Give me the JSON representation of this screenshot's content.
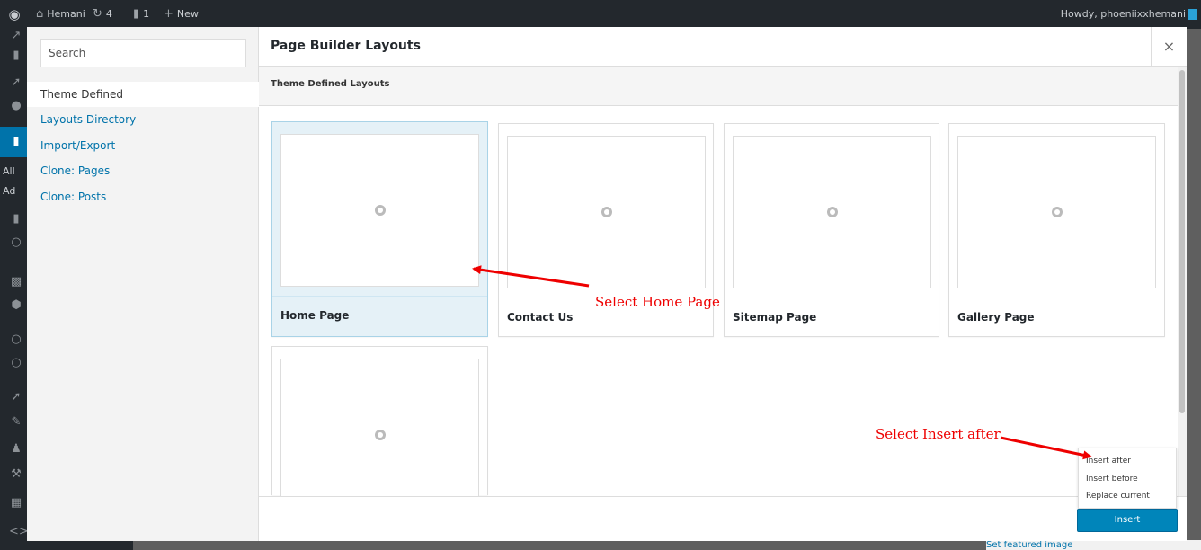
{
  "admin_bar": {
    "wp_logo_icon": "wordpress-icon",
    "site_name": "Hemani",
    "updates_count": "4",
    "comments_count": "1",
    "new_label": "New",
    "howdy": "Howdy, phoeniixxhemani"
  },
  "wp_sidebar": {
    "all_label": "All",
    "add_label": "Ad"
  },
  "modal": {
    "title": "Page Builder Layouts",
    "close_label": "×",
    "search": {
      "placeholder": "Search",
      "value": ""
    },
    "nav": [
      {
        "label": "Theme Defined",
        "selected": true
      },
      {
        "label": "Layouts Directory",
        "selected": false
      },
      {
        "label": "Import/Export",
        "selected": false
      },
      {
        "label": "Clone: Pages",
        "selected": false
      },
      {
        "label": "Clone: Posts",
        "selected": false
      }
    ],
    "section_title": "Theme Defined Layouts",
    "layouts": [
      {
        "name": "Home Page",
        "selected": true
      },
      {
        "name": "Contact Us",
        "selected": false
      },
      {
        "name": "Sitemap Page",
        "selected": false
      },
      {
        "name": "Gallery Page",
        "selected": false
      },
      {
        "name": "",
        "selected": false
      }
    ],
    "insert_menu": [
      "Insert after",
      "Insert before",
      "Replace current"
    ],
    "insert_button": "Insert"
  },
  "featured_image_link": "Set featured image",
  "annotations": {
    "select_home": "Select Home Page",
    "select_insert": "Select Insert after"
  },
  "colors": {
    "accent": "#0073aa",
    "button": "#0085ba",
    "annotation": "#e00000",
    "selected_card": "#e5f1f7"
  }
}
